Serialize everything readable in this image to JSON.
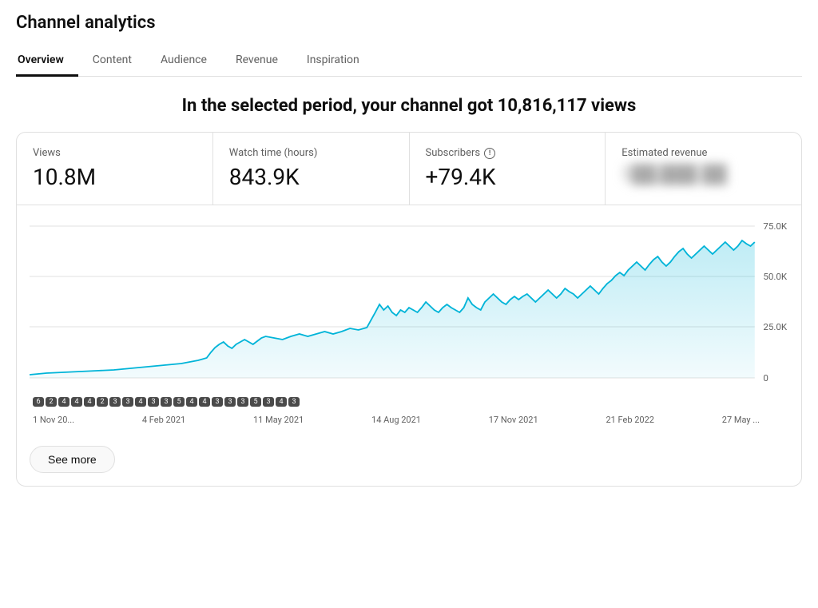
{
  "page": {
    "title": "Channel analytics"
  },
  "tabs": [
    {
      "id": "overview",
      "label": "Overview",
      "active": true
    },
    {
      "id": "content",
      "label": "Content",
      "active": false
    },
    {
      "id": "audience",
      "label": "Audience",
      "active": false
    },
    {
      "id": "revenue",
      "label": "Revenue",
      "active": false
    },
    {
      "id": "inspiration",
      "label": "Inspiration",
      "active": false
    }
  ],
  "headline": "In the selected period, your channel got 10,816,117 views",
  "metrics": [
    {
      "label": "Views",
      "value": "10.8M",
      "blurred": false,
      "warning": false
    },
    {
      "label": "Watch time (hours)",
      "value": "843.9K",
      "blurred": false,
      "warning": false
    },
    {
      "label": "Subscribers",
      "value": "+79.4K",
      "blurred": false,
      "warning": true
    },
    {
      "label": "Estimated revenue",
      "value": "██████ ███",
      "blurred": true,
      "warning": false
    }
  ],
  "chart": {
    "y_labels": [
      "75.0K",
      "50.0K",
      "25.0K",
      "0"
    ],
    "x_labels": [
      "1 Nov 20...",
      "4 Feb 2021",
      "11 May 2021",
      "14 Aug 2021",
      "17 Nov 2021",
      "21 Feb 2022",
      "27 May ..."
    ],
    "video_markers": [
      "6",
      "2",
      "4",
      "4",
      "4",
      "2",
      "3",
      "3",
      "4",
      "3",
      "3",
      "5",
      "4",
      "4",
      "3",
      "3",
      "3",
      "5",
      "3",
      "4",
      "3"
    ]
  },
  "see_more_label": "See more"
}
